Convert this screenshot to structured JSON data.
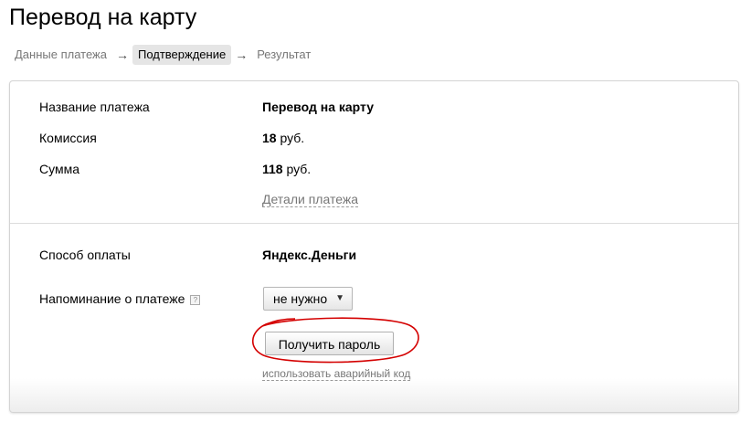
{
  "page": {
    "title": "Перевод на карту"
  },
  "steps": [
    {
      "label": "Данные платежа",
      "active": false
    },
    {
      "label": "Подтверждение",
      "active": true
    },
    {
      "label": "Результат",
      "active": false
    }
  ],
  "step_arrow": "→",
  "details": {
    "payment_name_label": "Название платежа",
    "payment_name_value": "Перевод на карту",
    "commission_label": "Комиссия",
    "commission_amount": "18",
    "commission_currency": "руб.",
    "sum_label": "Сумма",
    "sum_amount": "118",
    "sum_currency": "руб.",
    "details_link": "Детали платежа"
  },
  "payment": {
    "method_label": "Способ оплаты",
    "method_value": "Яндекс.Деньги",
    "reminder_label": "Напоминание о платеже",
    "reminder_help_icon": "?",
    "reminder_selected": "не нужно",
    "get_password_button": "Получить пароль",
    "emergency_code_link": "использовать аварийный код"
  },
  "colors": {
    "annotation_circle": "#d40000",
    "active_step_bg": "#e5e5e5"
  }
}
